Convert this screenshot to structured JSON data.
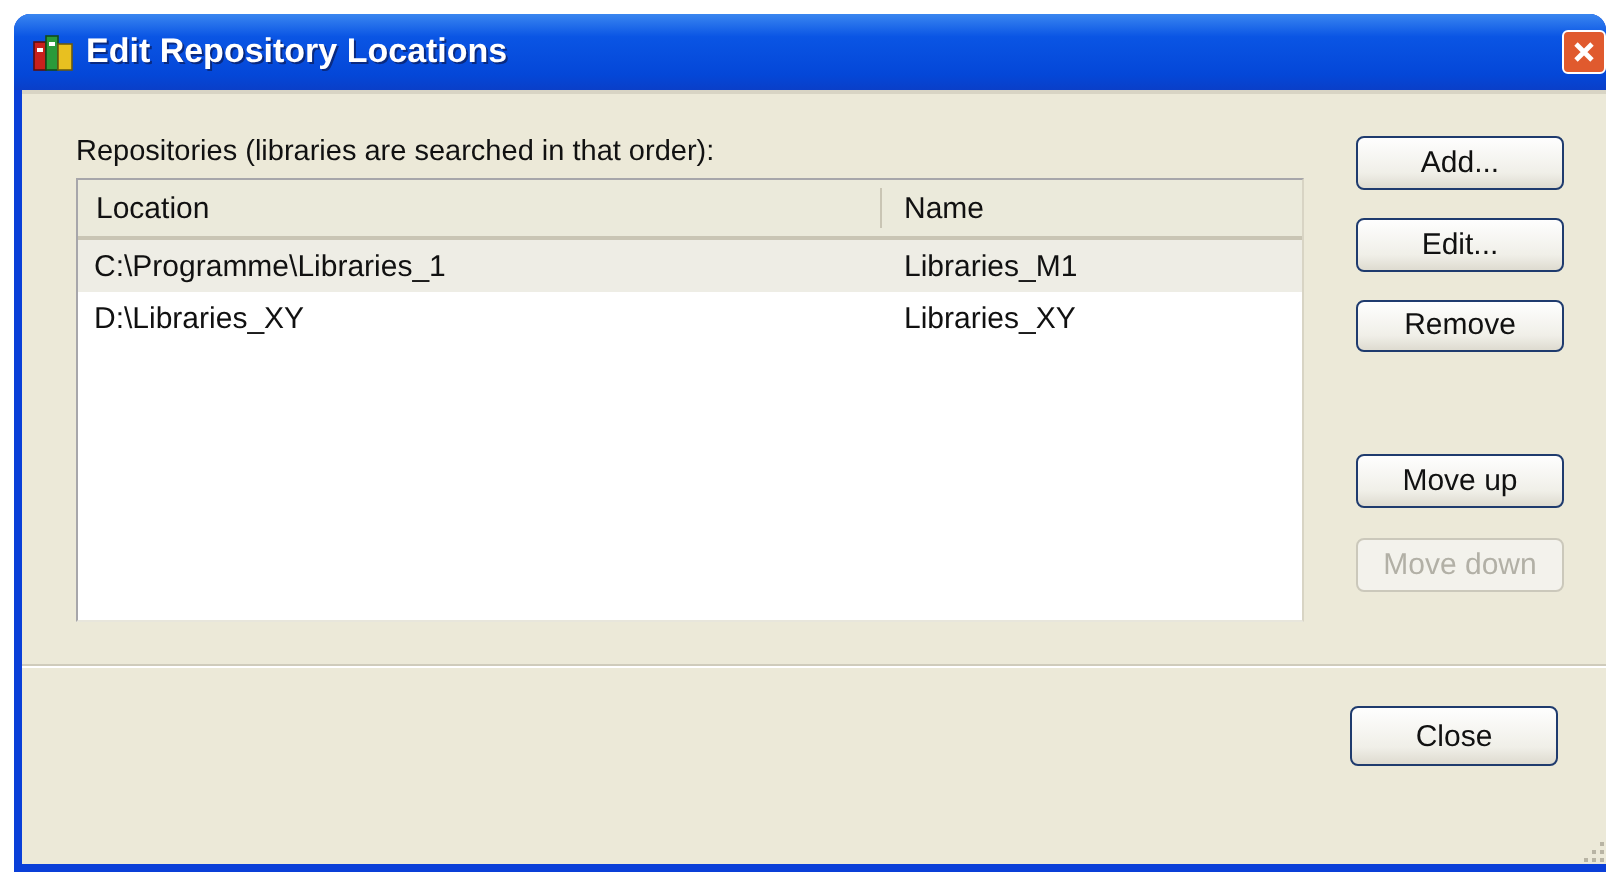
{
  "window": {
    "title": "Edit Repository Locations"
  },
  "list_label": "Repositories (libraries are searched in that order):",
  "table": {
    "columns": [
      "Location",
      "Name"
    ],
    "rows": [
      {
        "cells": [
          "C:\\Programme\\Libraries_1",
          "Libraries_M1"
        ],
        "selected": true
      },
      {
        "cells": [
          "D:\\Libraries_XY",
          "Libraries_XY"
        ],
        "selected": false
      }
    ]
  },
  "side_button_groups": [
    [
      {
        "label": "Add...",
        "disabled": false
      },
      {
        "label": "Edit...",
        "disabled": false
      },
      {
        "label": "Remove",
        "disabled": false
      }
    ],
    [
      {
        "label": "Move up",
        "disabled": false
      },
      {
        "label": "Move down",
        "disabled": true
      }
    ]
  ],
  "footer_buttons": [
    {
      "label": "Close",
      "disabled": false
    }
  ]
}
